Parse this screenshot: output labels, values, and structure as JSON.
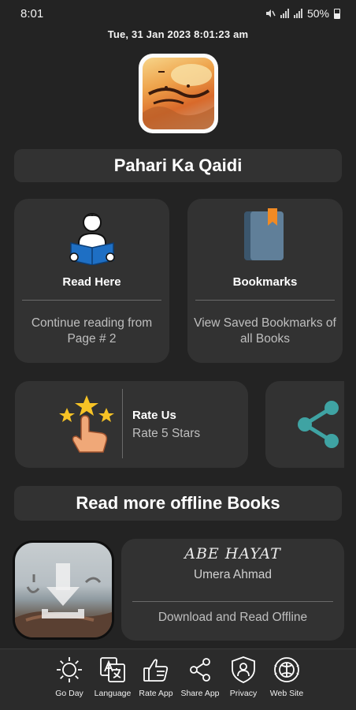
{
  "status_bar": {
    "time": "8:01",
    "battery": "50%"
  },
  "datetime": "Tue, 31  Jan  2023   8:01:23 am",
  "app": {
    "title": "Pahari Ka Qaidi"
  },
  "cards": {
    "read": {
      "title": "Read Here",
      "subtitle": "Continue reading from Page # 2"
    },
    "bookmarks": {
      "title": "Bookmarks",
      "subtitle": "View Saved Bookmarks of all Books"
    },
    "rate": {
      "title": "Rate Us",
      "subtitle": "Rate 5 Stars"
    }
  },
  "offline_section": {
    "title": "Read more offline Books"
  },
  "book": {
    "name": "ABE HAYAT",
    "author": "Umera Ahmad",
    "action": "Download and Read Offline"
  },
  "bottom_nav": [
    {
      "label": "Go Day",
      "icon": "sun-icon"
    },
    {
      "label": "Language",
      "icon": "translate-icon"
    },
    {
      "label": "Rate App",
      "icon": "thumbs-up-icon"
    },
    {
      "label": "Share App",
      "icon": "share-icon"
    },
    {
      "label": "Privacy",
      "icon": "shield-user-icon"
    },
    {
      "label": "Web Site",
      "icon": "globe-icon"
    }
  ],
  "colors": {
    "background": "#232323",
    "card": "#323232",
    "book_icon_blue": "#1e6fc4",
    "bookmark_orange": "#f08a24",
    "star_yellow": "#f7c325",
    "share_teal": "#3fa3a3"
  }
}
